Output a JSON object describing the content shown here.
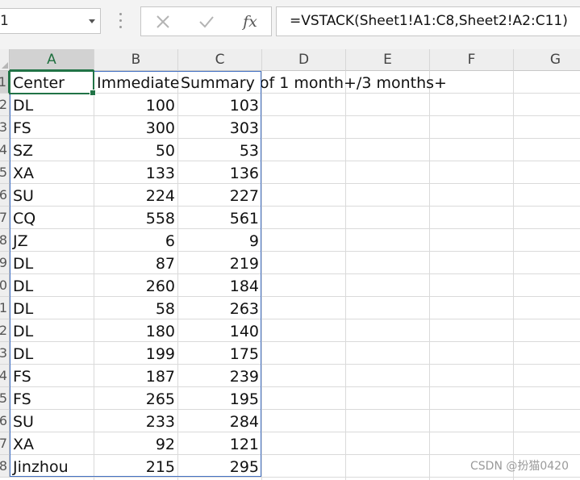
{
  "formula_bar": {
    "name_box": "1",
    "cancel_icon": "cancel-x-icon",
    "enter_icon": "check-icon",
    "fx_label": "fx",
    "formula": "=VSTACK(Sheet1!A1:C8,Sheet2!A2:C11)"
  },
  "columns": [
    "A",
    "B",
    "C",
    "D",
    "E",
    "F",
    "G"
  ],
  "row_numbers": [
    "1",
    "2",
    "3",
    "4",
    "5",
    "6",
    "7",
    "8",
    "9",
    "0",
    "1",
    "2",
    "3",
    "4",
    "5",
    "6",
    "7",
    "8"
  ],
  "header_row": [
    "Center",
    "Immediate",
    "Summary of 1 month+/3 months+"
  ],
  "rows": [
    {
      "center": "DL",
      "immediate": "100",
      "summary": "103"
    },
    {
      "center": "FS",
      "immediate": "300",
      "summary": "303"
    },
    {
      "center": "SZ",
      "immediate": "50",
      "summary": "53"
    },
    {
      "center": "XA",
      "immediate": "133",
      "summary": "136"
    },
    {
      "center": "SU",
      "immediate": "224",
      "summary": "227"
    },
    {
      "center": "CQ",
      "immediate": "558",
      "summary": "561"
    },
    {
      "center": "JZ",
      "immediate": "6",
      "summary": "9"
    },
    {
      "center": "DL",
      "immediate": "87",
      "summary": "219"
    },
    {
      "center": "DL",
      "immediate": "260",
      "summary": "184"
    },
    {
      "center": "DL",
      "immediate": "58",
      "summary": "263"
    },
    {
      "center": "DL",
      "immediate": "180",
      "summary": "140"
    },
    {
      "center": "DL",
      "immediate": "199",
      "summary": "175"
    },
    {
      "center": "FS",
      "immediate": "187",
      "summary": "239"
    },
    {
      "center": "FS",
      "immediate": "265",
      "summary": "195"
    },
    {
      "center": "SU",
      "immediate": "233",
      "summary": "284"
    },
    {
      "center": "XA",
      "immediate": "92",
      "summary": "121"
    },
    {
      "center": "Jinzhou",
      "immediate": "215",
      "summary": "295"
    }
  ],
  "watermark": "CSDN @扮猫0420",
  "colors": {
    "selection_green": "#217346",
    "spill_border": "#4472c4"
  }
}
